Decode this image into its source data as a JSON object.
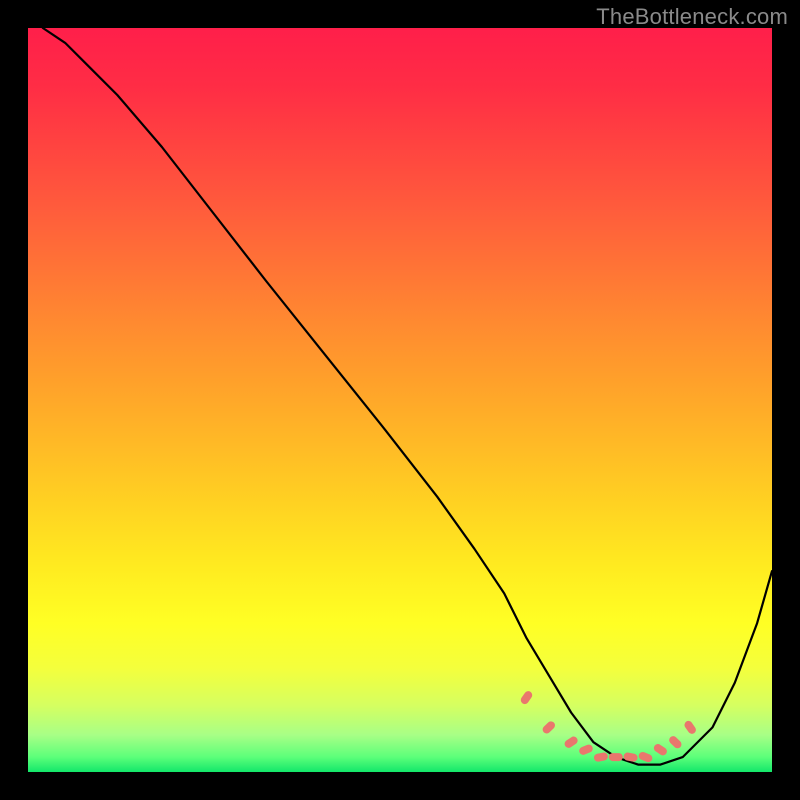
{
  "watermark": "TheBottleneck.com",
  "chart_data": {
    "type": "line",
    "title": "",
    "xlabel": "",
    "ylabel": "",
    "xlim": [
      0,
      100
    ],
    "ylim": [
      0,
      100
    ],
    "series": [
      {
        "name": "bottleneck-curve",
        "x": [
          2,
          5,
          8,
          12,
          18,
          25,
          32,
          40,
          48,
          55,
          60,
          64,
          67,
          70,
          73,
          76,
          79,
          82,
          85,
          88,
          92,
          95,
          98,
          100
        ],
        "values": [
          100,
          98,
          95,
          91,
          84,
          75,
          66,
          56,
          46,
          37,
          30,
          24,
          18,
          13,
          8,
          4,
          2,
          1,
          1,
          2,
          6,
          12,
          20,
          27
        ]
      }
    ],
    "marker_band": {
      "name": "optimal-range-markers",
      "x": [
        67,
        70,
        73,
        75,
        77,
        79,
        81,
        83,
        85,
        87,
        89
      ],
      "values": [
        10,
        6,
        4,
        3,
        2,
        2,
        2,
        2,
        3,
        4,
        6
      ]
    },
    "gradient_colors": {
      "top": "#ff1f4a",
      "mid": "#ffea20",
      "bottom": "#13e76a"
    }
  }
}
